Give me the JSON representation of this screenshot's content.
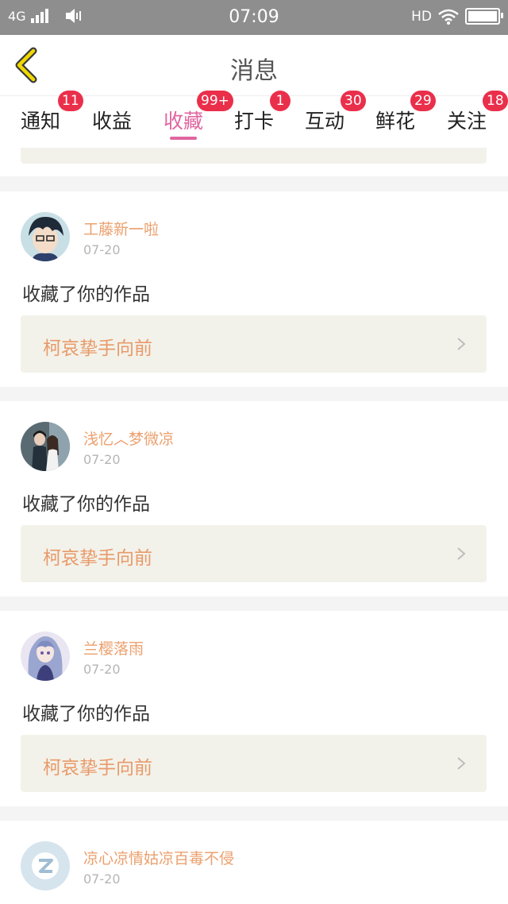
{
  "status_bar": {
    "network": "4G",
    "time": "07:09",
    "hd": "HD"
  },
  "header": {
    "title": "消息"
  },
  "tabs": [
    {
      "label": "通知",
      "badge": "11",
      "active": false
    },
    {
      "label": "收益",
      "badge": "",
      "active": false
    },
    {
      "label": "收藏",
      "badge": "99+",
      "active": true
    },
    {
      "label": "打卡",
      "badge": "1",
      "active": false
    },
    {
      "label": "互动",
      "badge": "30",
      "active": false
    },
    {
      "label": "鲜花",
      "badge": "29",
      "active": false
    },
    {
      "label": "关注",
      "badge": "18",
      "active": false
    }
  ],
  "colors": {
    "accent": "#e066a0",
    "badge": "#ea2f4b",
    "username": "#eba06e",
    "work_title": "#e89a6a",
    "work_box": "#f3f2ea"
  },
  "messages": [
    {
      "username": "工藤新一啦",
      "date": "07-20",
      "action": "收藏了你的作品",
      "work_title": "柯哀挚手向前",
      "avatar": "anime-boy-avatar"
    },
    {
      "username": "浅忆︿梦微凉",
      "date": "07-20",
      "action": "收藏了你的作品",
      "work_title": "柯哀挚手向前",
      "avatar": "couple-photo-avatar"
    },
    {
      "username": "兰樱落雨",
      "date": "07-20",
      "action": "收藏了你的作品",
      "work_title": "柯哀挚手向前",
      "avatar": "anime-girl-avatar"
    },
    {
      "username": "凉心凉情姑凉百毒不侵",
      "date": "07-20",
      "avatar": "default-avatar"
    }
  ]
}
